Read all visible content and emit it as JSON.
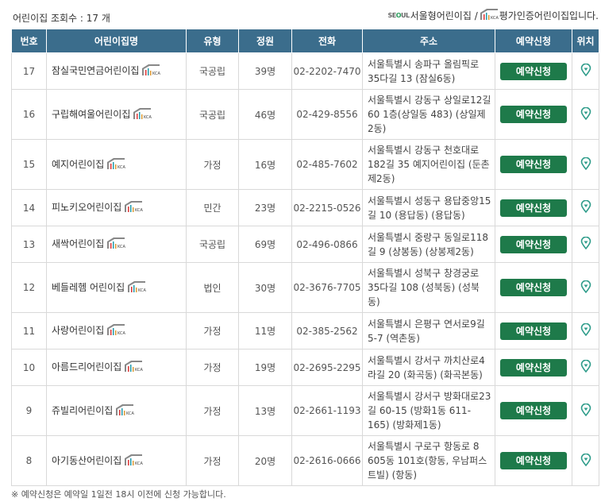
{
  "header": {
    "count_text": "어린이집 조회수 : 17 개",
    "seoul_logo_text": "SEOUL",
    "legend_seoul": "서울형어린이집 /",
    "legend_certified": "평가인증어린이집입니다."
  },
  "columns": [
    "번호",
    "어린이집명",
    "유형",
    "정원",
    "전화",
    "주소",
    "예약신청",
    "위치"
  ],
  "rows": [
    {
      "no": "17",
      "name": "잠실국민연금어린이집",
      "type": "국공립",
      "capacity": "39명",
      "phone": "02-2202-7470",
      "address": "서울특별시 송파구 올림픽로 35다길 13 (잠실6동)",
      "reserve": "예약신청"
    },
    {
      "no": "16",
      "name": "구립해여울어린이집",
      "type": "국공립",
      "capacity": "46명",
      "phone": "02-429-8556",
      "address": "서울특별시 강동구 상일로12길 60 1층(상일동 483) (상일제2동)",
      "reserve": "예약신청"
    },
    {
      "no": "15",
      "name": "예지어린이집",
      "type": "가정",
      "capacity": "16명",
      "phone": "02-485-7602",
      "address": "서울특별시 강동구 천호대로 182길 35 예지어린이집 (둔촌제2동)",
      "reserve": "예약신청"
    },
    {
      "no": "14",
      "name": "피노키오어린이집",
      "type": "민간",
      "capacity": "23명",
      "phone": "02-2215-0526",
      "address": "서울특별시 성동구 용답중앙15길 10 (용답동) (용답동)",
      "reserve": "예약신청"
    },
    {
      "no": "13",
      "name": "새싹어린이집",
      "type": "국공립",
      "capacity": "69명",
      "phone": "02-496-0866",
      "address": "서울특별시 중랑구 동일로118길 9 (상봉동) (상봉제2동)",
      "reserve": "예약신청"
    },
    {
      "no": "12",
      "name": "베들레헴 어린이집",
      "type": "법인",
      "capacity": "30명",
      "phone": "02-3676-7705",
      "address": "서울특별시 성북구 창경궁로 35다길 108 (성북동) (성북동)",
      "reserve": "예약신청"
    },
    {
      "no": "11",
      "name": "사랑어린이집",
      "type": "가정",
      "capacity": "11명",
      "phone": "02-385-2562",
      "address": "서울특별시 은평구 연서로9길 5-7 (역촌동)",
      "reserve": "예약신청"
    },
    {
      "no": "10",
      "name": "아름드리어린이집",
      "type": "가정",
      "capacity": "19명",
      "phone": "02-2695-2295",
      "address": "서울특별시 강서구 까치산로4라길 20 (화곡동) (화곡본동)",
      "reserve": "예약신청"
    },
    {
      "no": "9",
      "name": "쥬빌리어린이집",
      "type": "가정",
      "capacity": "13명",
      "phone": "02-2661-1193",
      "address": "서울특별시 강서구 방화대로23길 60-15 (방화1동 611-165) (방화제1동)",
      "reserve": "예약신청"
    },
    {
      "no": "8",
      "name": "아기동산어린이집",
      "type": "가정",
      "capacity": "20명",
      "phone": "02-2616-0666",
      "address": "서울특별시 구로구 항동로 8 605동 101호(항동, 우남퍼스트빌) (항동)",
      "reserve": "예약신청"
    }
  ],
  "footnote": "※ 예약신청은 예약일 1일전 18시 이전에 신청 가능합니다.",
  "icons": {
    "certified": "kcac-certified-icon",
    "location": "map-pin-icon"
  },
  "colors": {
    "header_bg": "#3b6d8c",
    "button_bg": "#1e7a4a",
    "pin": "#2e9c8a"
  }
}
